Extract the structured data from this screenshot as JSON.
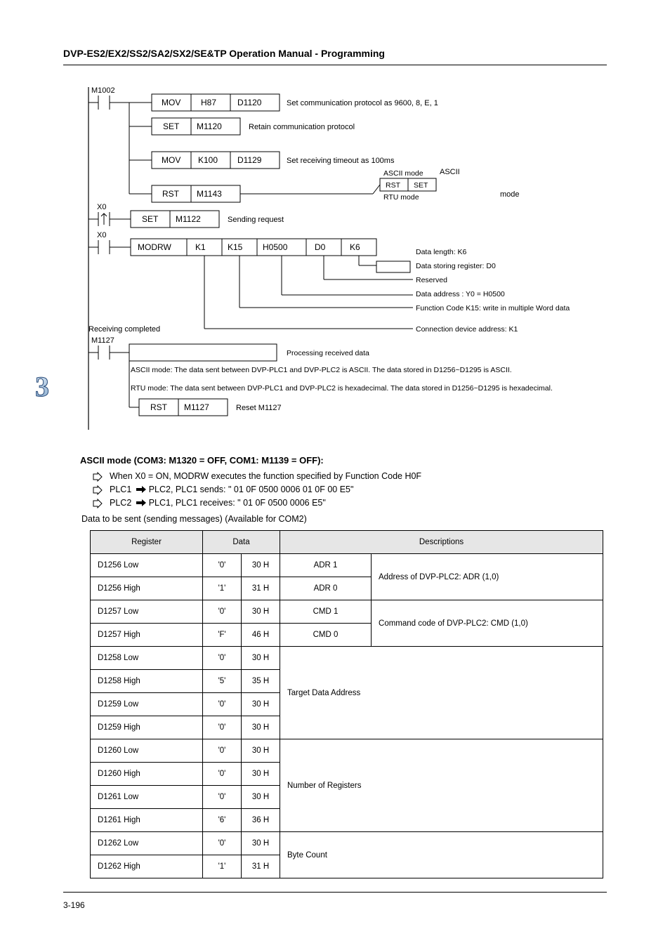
{
  "header": {
    "left": "DVP-ES2/EX2/SS2/SA2/SX2/SE&TP Operation Manual - Programming",
    "right": ""
  },
  "footer": {
    "left": "3-196",
    "right": ""
  },
  "chapter_digit": "3",
  "diagram": {
    "rung1": {
      "contact": "M1002",
      "b1_op": "MOV",
      "b1_a": "H87",
      "b1_b": "D1120",
      "comment1": "Set communication protocol as 9600, 8, E, 1",
      "b2": "SET",
      "b2_a": "M1120",
      "comment2": "Retain communication protocol",
      "b3_op": "MOV",
      "b3_a": "K100",
      "b3_b": "D1129",
      "comment3": "Set receiving timeout as 100ms",
      "b4": "RST",
      "b4_a": "M1143",
      "comment4top": "ASCII",
      "comment4": "mode",
      "switch_left": "ASCII mode",
      "switch_right": "RTU mode",
      "b4s": "SET"
    },
    "rung2": {
      "contact": "X0",
      "b": "SET",
      "b_a": "M1122",
      "comment": "Sending request"
    },
    "rung3": {
      "contact": "X0",
      "op": "MODRW",
      "a1": "K1",
      "a2": "K15",
      "a3": "H0500",
      "a4": "D0",
      "a5": "K6",
      "note_datalen": "Data length: K6",
      "note_register": "Data storing register: D0",
      "note_reserved": "Reserved",
      "note_dataaddr": "Data address : Y0 = H0500",
      "note_funccode": "Function Code K15:                                              write in multiple Word data",
      "note_connaddr": "Connection device address: K1"
    },
    "rung4a": {
      "label": "Receiving completed",
      "contact": "M1127",
      "comment": "Processing received data",
      "ascii": "ASCII mode: The data sent between DVP-PLC1 and DVP-PLC2 is ASCII.                     The data stored in D1256~D1295 is ASCII.",
      "rtu": "RTU mode: The data sent between DVP-PLC1 and DVP-PLC2 is hexadecimal.                     The data stored in D1256~D1295 is hexadecimal."
    },
    "rung4b": {
      "b": "RST",
      "b_a": "M1127",
      "comment": "Reset M1127"
    }
  },
  "remarks": {
    "title": "ASCII mode (COM3: M1320 = OFF, COM1: M1139 = OFF):",
    "bullets": [
      "When X0 = ON, MODRW executes the function specified by Function Code H0F",
      "PLC1 🡺 PLC2, PLC1 sends: \"01 0F 0500 0006 01 0F 00 E5\"",
      "PLC2 🡺 PLC1, PLC1 receives: \"01 0F 0500 0006 E5\""
    ],
    "bullets_plain": [
      "When X0 = ON, MODRW executes the function specified by Function Code H0F",
      "PLC1 ",
      "PLC2 "
    ],
    "b2_rest": "PLC2, PLC1 sends: \" 01 0F 0500 0006 01 0F 00 E5\"",
    "b3_rest": "PLC1, PLC1 receives: \" 01 0F 0500 0006 E5\"",
    "tabletitle": "(Available for COM2)"
  },
  "table": {
    "headers": [
      "Register",
      "Data",
      "Descriptions"
    ],
    "rows": [
      {
        "k": "D1256 Low",
        "h": "'0'",
        "v": "30 H",
        "d": "ADR 1",
        "r": "Address of DVP-PLC2: ADR (1,0)",
        "span": 2
      },
      {
        "k": "D1256 High",
        "h": "'1'",
        "v": "31 H",
        "d": "ADR 0"
      },
      {
        "k": "D1257 Low",
        "h": "'0'",
        "v": "30 H",
        "d": "CMD 1",
        "r": "Command code of DVP-PLC2: CMD (1,0)",
        "span": 2
      },
      {
        "k": "D1257 High",
        "h": "'F'",
        "v": "46 H",
        "d": "CMD 0"
      },
      {
        "k": "D1258 Low",
        "h": "'0'",
        "v": "30 H",
        "d": "",
        "r": "Target Data Address",
        "span": 4
      },
      {
        "k": "D1258 High",
        "h": "'5'",
        "v": "35 H",
        "d": ""
      },
      {
        "k": "D1259 Low",
        "h": "'0'",
        "v": "30 H",
        "d": ""
      },
      {
        "k": "D1259 High",
        "h": "'0'",
        "v": "30 H",
        "d": ""
      },
      {
        "k": "D1260 Low",
        "h": "'0'",
        "v": "30 H",
        "d": "",
        "r": "Number of Registers",
        "span": 4
      },
      {
        "k": "D1260 High",
        "h": "'0'",
        "v": "30 H",
        "d": ""
      },
      {
        "k": "D1261 Low",
        "h": "'0'",
        "v": "30 H",
        "d": ""
      },
      {
        "k": "D1261 High",
        "h": "'6'",
        "v": "36 H",
        "d": ""
      },
      {
        "k": "D1262 Low",
        "h": "'0'",
        "v": "30 H",
        "d": "",
        "r": "Byte Count",
        "span": 2
      },
      {
        "k": "D1262 High",
        "h": "'1'",
        "v": "31 H",
        "d": ""
      }
    ]
  }
}
